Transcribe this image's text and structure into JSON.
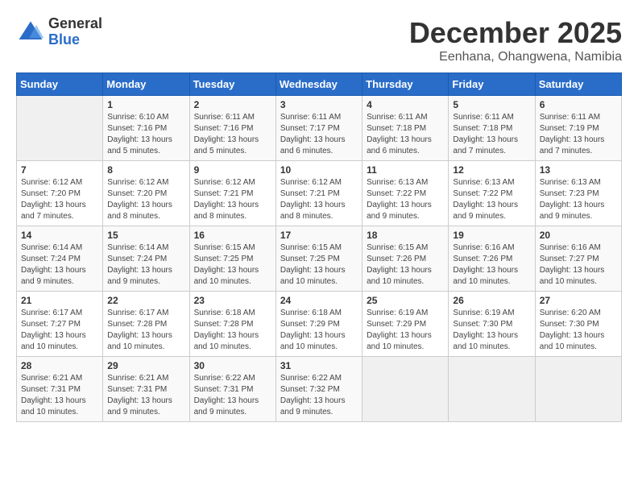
{
  "header": {
    "logo_general": "General",
    "logo_blue": "Blue",
    "month_title": "December 2025",
    "location": "Eenhana, Ohangwena, Namibia"
  },
  "days_of_week": [
    "Sunday",
    "Monday",
    "Tuesday",
    "Wednesday",
    "Thursday",
    "Friday",
    "Saturday"
  ],
  "weeks": [
    [
      {
        "day": "",
        "sunrise": "",
        "sunset": "",
        "daylight": ""
      },
      {
        "day": "1",
        "sunrise": "6:10 AM",
        "sunset": "7:16 PM",
        "daylight": "13 hours and 5 minutes."
      },
      {
        "day": "2",
        "sunrise": "6:11 AM",
        "sunset": "7:16 PM",
        "daylight": "13 hours and 5 minutes."
      },
      {
        "day": "3",
        "sunrise": "6:11 AM",
        "sunset": "7:17 PM",
        "daylight": "13 hours and 6 minutes."
      },
      {
        "day": "4",
        "sunrise": "6:11 AM",
        "sunset": "7:18 PM",
        "daylight": "13 hours and 6 minutes."
      },
      {
        "day": "5",
        "sunrise": "6:11 AM",
        "sunset": "7:18 PM",
        "daylight": "13 hours and 7 minutes."
      },
      {
        "day": "6",
        "sunrise": "6:11 AM",
        "sunset": "7:19 PM",
        "daylight": "13 hours and 7 minutes."
      }
    ],
    [
      {
        "day": "7",
        "sunrise": "6:12 AM",
        "sunset": "7:20 PM",
        "daylight": "13 hours and 7 minutes."
      },
      {
        "day": "8",
        "sunrise": "6:12 AM",
        "sunset": "7:20 PM",
        "daylight": "13 hours and 8 minutes."
      },
      {
        "day": "9",
        "sunrise": "6:12 AM",
        "sunset": "7:21 PM",
        "daylight": "13 hours and 8 minutes."
      },
      {
        "day": "10",
        "sunrise": "6:12 AM",
        "sunset": "7:21 PM",
        "daylight": "13 hours and 8 minutes."
      },
      {
        "day": "11",
        "sunrise": "6:13 AM",
        "sunset": "7:22 PM",
        "daylight": "13 hours and 9 minutes."
      },
      {
        "day": "12",
        "sunrise": "6:13 AM",
        "sunset": "7:22 PM",
        "daylight": "13 hours and 9 minutes."
      },
      {
        "day": "13",
        "sunrise": "6:13 AM",
        "sunset": "7:23 PM",
        "daylight": "13 hours and 9 minutes."
      }
    ],
    [
      {
        "day": "14",
        "sunrise": "6:14 AM",
        "sunset": "7:24 PM",
        "daylight": "13 hours and 9 minutes."
      },
      {
        "day": "15",
        "sunrise": "6:14 AM",
        "sunset": "7:24 PM",
        "daylight": "13 hours and 9 minutes."
      },
      {
        "day": "16",
        "sunrise": "6:15 AM",
        "sunset": "7:25 PM",
        "daylight": "13 hours and 10 minutes."
      },
      {
        "day": "17",
        "sunrise": "6:15 AM",
        "sunset": "7:25 PM",
        "daylight": "13 hours and 10 minutes."
      },
      {
        "day": "18",
        "sunrise": "6:15 AM",
        "sunset": "7:26 PM",
        "daylight": "13 hours and 10 minutes."
      },
      {
        "day": "19",
        "sunrise": "6:16 AM",
        "sunset": "7:26 PM",
        "daylight": "13 hours and 10 minutes."
      },
      {
        "day": "20",
        "sunrise": "6:16 AM",
        "sunset": "7:27 PM",
        "daylight": "13 hours and 10 minutes."
      }
    ],
    [
      {
        "day": "21",
        "sunrise": "6:17 AM",
        "sunset": "7:27 PM",
        "daylight": "13 hours and 10 minutes."
      },
      {
        "day": "22",
        "sunrise": "6:17 AM",
        "sunset": "7:28 PM",
        "daylight": "13 hours and 10 minutes."
      },
      {
        "day": "23",
        "sunrise": "6:18 AM",
        "sunset": "7:28 PM",
        "daylight": "13 hours and 10 minutes."
      },
      {
        "day": "24",
        "sunrise": "6:18 AM",
        "sunset": "7:29 PM",
        "daylight": "13 hours and 10 minutes."
      },
      {
        "day": "25",
        "sunrise": "6:19 AM",
        "sunset": "7:29 PM",
        "daylight": "13 hours and 10 minutes."
      },
      {
        "day": "26",
        "sunrise": "6:19 AM",
        "sunset": "7:30 PM",
        "daylight": "13 hours and 10 minutes."
      },
      {
        "day": "27",
        "sunrise": "6:20 AM",
        "sunset": "7:30 PM",
        "daylight": "13 hours and 10 minutes."
      }
    ],
    [
      {
        "day": "28",
        "sunrise": "6:21 AM",
        "sunset": "7:31 PM",
        "daylight": "13 hours and 10 minutes."
      },
      {
        "day": "29",
        "sunrise": "6:21 AM",
        "sunset": "7:31 PM",
        "daylight": "13 hours and 9 minutes."
      },
      {
        "day": "30",
        "sunrise": "6:22 AM",
        "sunset": "7:31 PM",
        "daylight": "13 hours and 9 minutes."
      },
      {
        "day": "31",
        "sunrise": "6:22 AM",
        "sunset": "7:32 PM",
        "daylight": "13 hours and 9 minutes."
      },
      {
        "day": "",
        "sunrise": "",
        "sunset": "",
        "daylight": ""
      },
      {
        "day": "",
        "sunrise": "",
        "sunset": "",
        "daylight": ""
      },
      {
        "day": "",
        "sunrise": "",
        "sunset": "",
        "daylight": ""
      }
    ]
  ],
  "labels": {
    "sunrise_prefix": "Sunrise: ",
    "sunset_prefix": "Sunset: ",
    "daylight_prefix": "Daylight: "
  }
}
